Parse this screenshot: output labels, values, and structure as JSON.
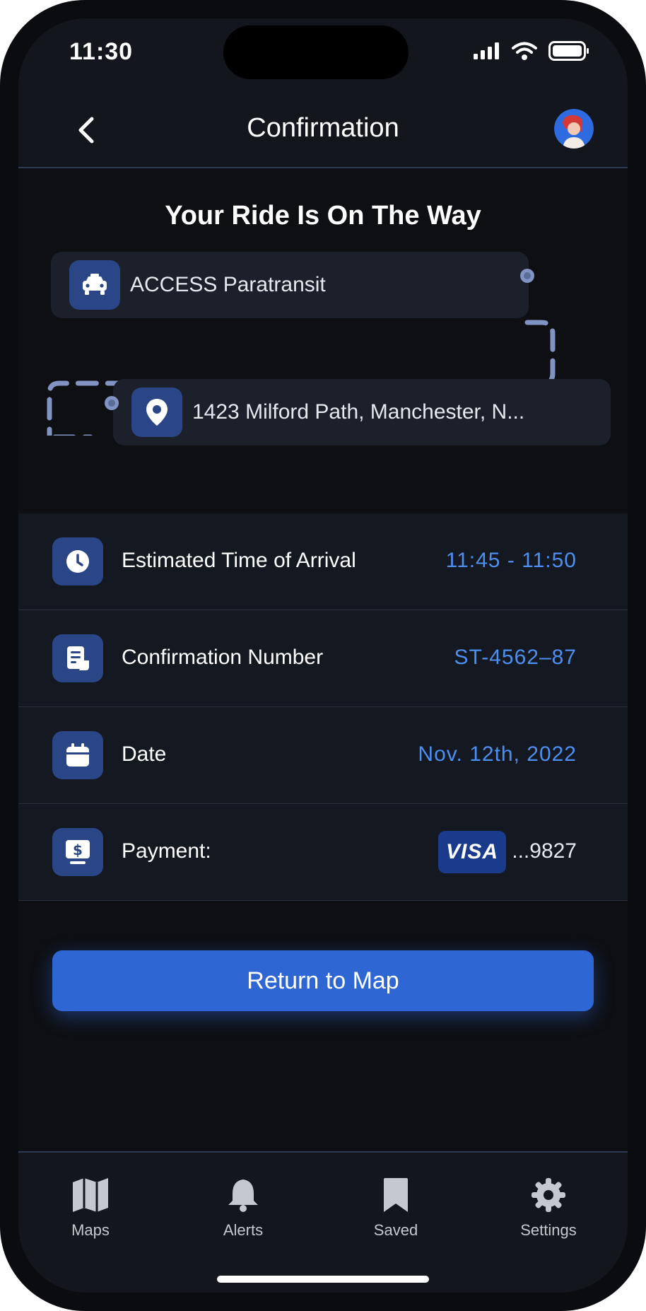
{
  "status": {
    "time": "11:30"
  },
  "header": {
    "title": "Confirmation"
  },
  "headline": "Your Ride Is On The Way",
  "route": {
    "origin": "ACCESS Paratransit",
    "destination": "1423 Milford Path, Manchester, N..."
  },
  "details": {
    "eta": {
      "label": "Estimated Time of Arrival",
      "value": "11:45 - 11:50"
    },
    "confirmation": {
      "label": "Confirmation Number",
      "value": "ST-4562–87"
    },
    "date": {
      "label": "Date",
      "value": "Nov. 12th, 2022"
    },
    "payment": {
      "label": "Payment:",
      "card_brand": "VISA",
      "card_last4": "...9827"
    }
  },
  "cta": {
    "label": "Return to Map"
  },
  "tabs": [
    {
      "label": "Maps",
      "icon": "map-icon"
    },
    {
      "label": "Alerts",
      "icon": "bell-icon"
    },
    {
      "label": "Saved",
      "icon": "bookmark-icon"
    },
    {
      "label": "Settings",
      "icon": "gear-icon"
    }
  ],
  "colors": {
    "accent": "#2e67d4",
    "value_text": "#4d8ff0",
    "icon_bg": "#2a4687",
    "route_dash": "#8093c2"
  }
}
